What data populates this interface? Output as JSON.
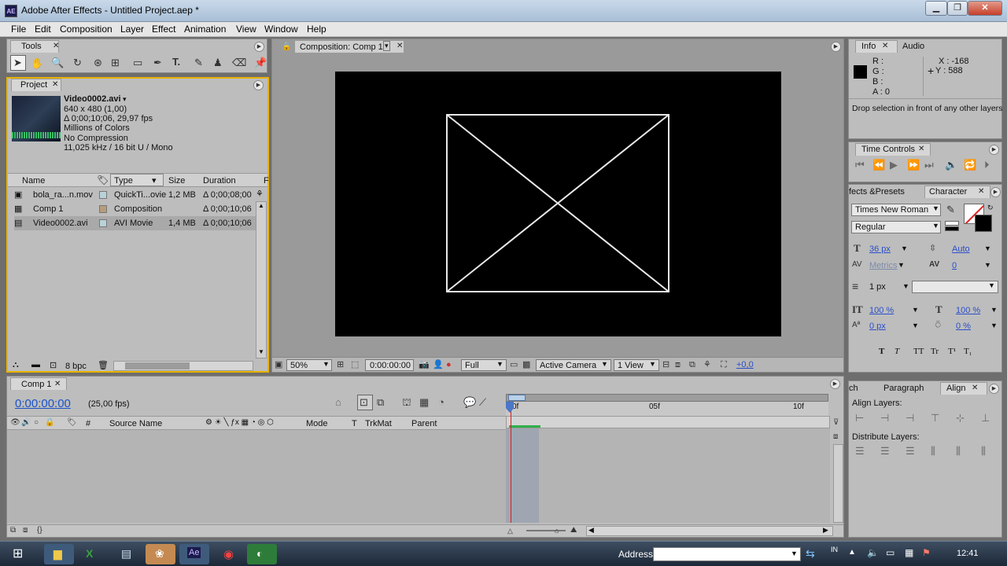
{
  "window": {
    "title": "Adobe After Effects - Untitled Project.aep *",
    "app_icon": "AE"
  },
  "menubar": [
    "File",
    "Edit",
    "Composition",
    "Layer",
    "Effect",
    "Animation",
    "View",
    "Window",
    "Help"
  ],
  "tools_panel": {
    "tab": "Tools"
  },
  "project_panel": {
    "tab": "Project",
    "preview": {
      "name": "Video0002.avi",
      "lines": [
        "640 x 480 (1,00)",
        "Δ 0;00;10;06, 29,97 fps",
        "Millions of Colors",
        "No Compression",
        "11,025 kHz / 16 bit U / Mono"
      ]
    },
    "columns": [
      "Name",
      "Type",
      "Size",
      "Duration",
      "F"
    ],
    "items": [
      {
        "name": "bola_ra...n.mov",
        "type": "QuickTi...ovie",
        "size": "1,2 MB",
        "duration": "Δ 0;00;08;00",
        "label_color": "#b9d2d8"
      },
      {
        "name": "Comp 1",
        "type": "Composition",
        "size": "",
        "duration": "Δ 0;00;10;06",
        "label_color": "#b69c7a"
      },
      {
        "name": "Video0002.avi",
        "type": "AVI Movie",
        "size": "1,4 MB",
        "duration": "Δ 0;00;10;06",
        "label_color": "#b9d2d8"
      }
    ],
    "bpc": "8 bpc"
  },
  "composition_panel": {
    "tab": "Composition: Comp 1",
    "zoom": "50%",
    "timecode": "0:00:00:00",
    "resolution": "Full",
    "camera": "Active Camera",
    "views": "1 View",
    "exposure": "+0,0"
  },
  "info_panel": {
    "tabs": [
      "Info",
      "Audio"
    ],
    "channels": [
      "R :",
      "G :",
      "B :",
      "A : 0"
    ],
    "x": "X : -168",
    "y": "Y : 588",
    "message": "Drop selection in front of any other layers"
  },
  "time_controls": {
    "tab": "Time Controls"
  },
  "character_panel": {
    "tabs": [
      "fects &Presets",
      "Character"
    ],
    "font": "Times New Roman",
    "style": "Regular",
    "font_size": "36 px",
    "leading": "Auto",
    "kerning": "Metrics",
    "tracking": "0",
    "stroke_width": "1 px",
    "vscale": "100 %",
    "hscale": "100 %",
    "baseline": "0 px",
    "tsume": "0 %",
    "text_styles": [
      "T",
      "T",
      "TT",
      "Tr",
      "T¹",
      "T₁"
    ]
  },
  "align_panel": {
    "tabs": [
      "ch",
      "Paragraph",
      "Align"
    ],
    "align_label": "Align Layers:",
    "distribute_label": "Distribute Layers:"
  },
  "timeline": {
    "tab": "Comp 1",
    "timecode": "0:00:00:00",
    "fps": "(25,00 fps)",
    "columns": {
      "source": "Source Name",
      "mode": "Mode",
      "t": "T",
      "trkmat": "TrkMat",
      "parent": "Parent",
      "hash": "#"
    },
    "ruler": [
      "0f",
      "05f",
      "10f"
    ]
  },
  "taskbar": {
    "address_label": "Address",
    "lang": "IN",
    "clock": "12:41"
  },
  "colors": {
    "panel": "#bdbdbd",
    "accent_yellow": "#e8b300",
    "timecode_blue": "#1a52c8",
    "cti_red": "#d42020"
  }
}
